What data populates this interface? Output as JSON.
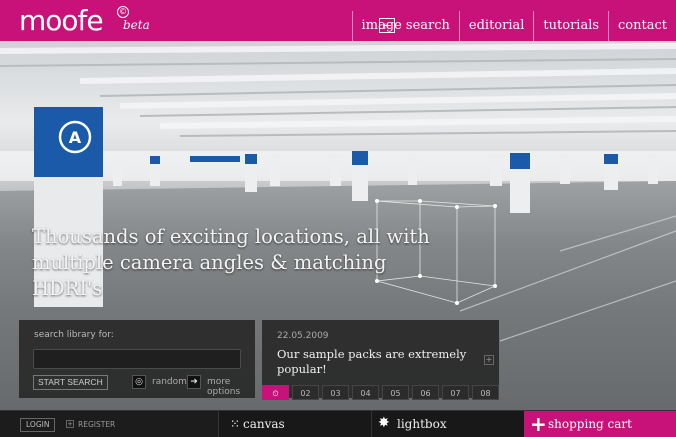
{
  "header": {
    "logo": "moofe",
    "logo_mark": "©",
    "beta": "beta",
    "back_icon": "←",
    "nav": [
      "image search",
      "editorial",
      "tutorials",
      "contact"
    ]
  },
  "hero": {
    "headline": "Thousands of exciting locations, all with multiple camera angles & matching HDRI's",
    "pillar_label": "A"
  },
  "search": {
    "label": "search library for:",
    "value": "",
    "start_label": "START SEARCH",
    "random_icon": "◎",
    "random_label": "random",
    "more_icon": "➜",
    "more_label": "more options"
  },
  "news": {
    "date": "22.05.2009",
    "text": "Our sample packs are extremely popular!",
    "more_icon": "+",
    "pages": [
      "⏲",
      "02",
      "03",
      "04",
      "05",
      "06",
      "07",
      "08"
    ]
  },
  "footer": {
    "login": "LOGIN",
    "register_icon": "+",
    "register": "REGISTER",
    "canvas_icon": "⁙",
    "canvas": "canvas",
    "lightbox_icon": "✸",
    "lightbox": "lightbox",
    "cart_icon": "+",
    "cart": "shopping cart"
  },
  "colors": {
    "brand": "#c8127a",
    "pillar_blue": "#1a5aa8"
  }
}
